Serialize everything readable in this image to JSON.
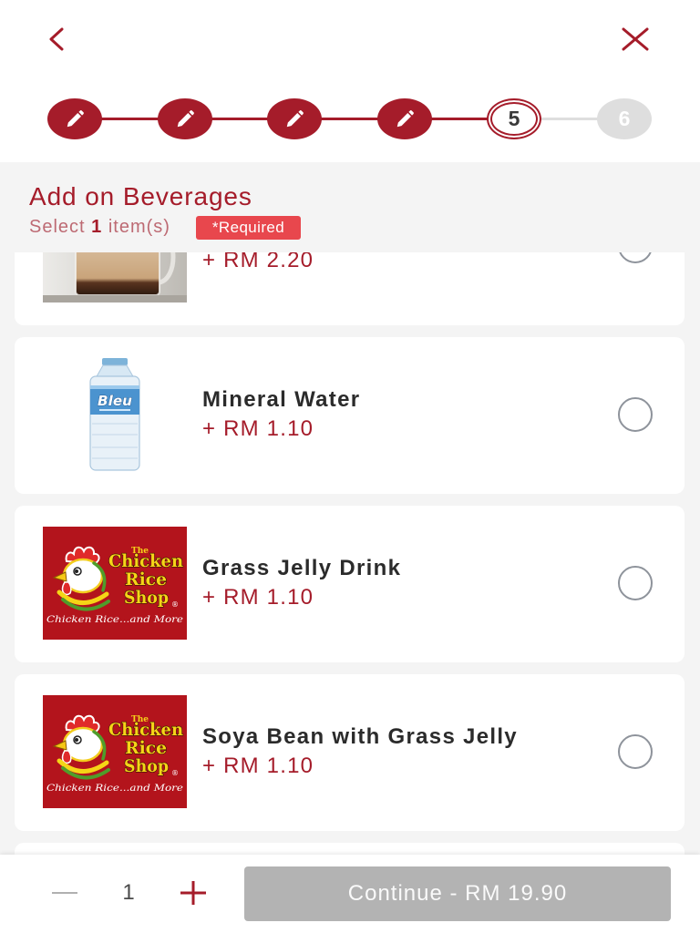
{
  "nav": {
    "back_icon": "chevron-left-icon",
    "close_icon": "close-icon"
  },
  "stepper": {
    "steps": [
      {
        "state": "completed",
        "icon": "pencil-icon"
      },
      {
        "state": "completed",
        "icon": "pencil-icon"
      },
      {
        "state": "completed",
        "icon": "pencil-icon"
      },
      {
        "state": "completed",
        "icon": "pencil-icon"
      },
      {
        "state": "current",
        "label": "5"
      },
      {
        "state": "upcoming",
        "label": "6"
      }
    ]
  },
  "section": {
    "title": "Add on Beverages",
    "select_prefix": "Select",
    "select_count": "1",
    "select_suffix": "item(s)",
    "required_badge": "*Required"
  },
  "items": [
    {
      "price": "+ RM 2.20",
      "image": "milk-tea-glass",
      "selected": false
    },
    {
      "name": "Mineral Water",
      "price": "+ RM 1.10",
      "image": "water-bottle",
      "image_label": "Bleu",
      "selected": false
    },
    {
      "name": "Grass Jelly Drink",
      "price": "+ RM 1.10",
      "image": "brand-logo",
      "selected": false
    },
    {
      "name": "Soya Bean with Grass Jelly",
      "price": "+ RM 1.10",
      "image": "brand-logo",
      "selected": false
    }
  ],
  "brand_logo": {
    "the": "The",
    "line1": "Chicken",
    "line2": "Rice",
    "line3": "Shop",
    "reg": "®",
    "tagline": "Chicken Rice...and More"
  },
  "footer": {
    "minus_icon": "minus-icon",
    "quantity": "1",
    "plus_icon": "plus-icon",
    "continue_label": "Continue - RM 19.90"
  },
  "colors": {
    "accent": "#a51c2a",
    "badge": "#e8474d",
    "background": "#f4f4f4",
    "subtitle": "#bd6a73",
    "radio": "#8e939b",
    "button_disabled": "#b3b3b3",
    "step_upcoming": "#dedede"
  }
}
